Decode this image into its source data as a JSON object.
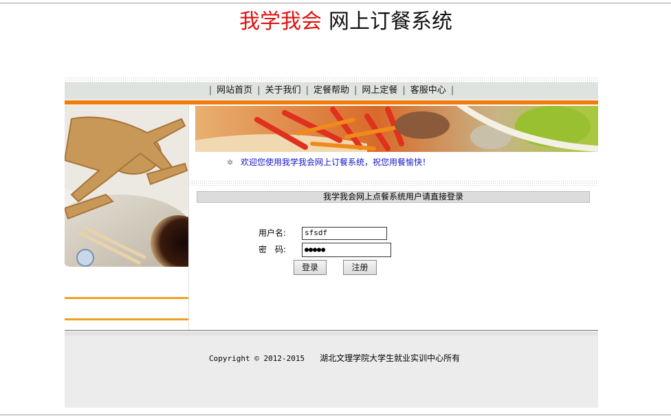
{
  "header": {
    "title_red": "我学我会",
    "title_black": "网上订餐系统"
  },
  "nav": {
    "items": [
      {
        "label": "网站首页"
      },
      {
        "label": "关于我们"
      },
      {
        "label": "定餐帮助"
      },
      {
        "label": "网上定餐"
      },
      {
        "label": "客服中心"
      }
    ]
  },
  "welcome": {
    "icon": "sparkle-icon",
    "text": "欢迎您使用我学我会网上订餐系统，祝您用餐愉快！"
  },
  "login": {
    "panel_title": "我学我会网上点餐系统用户请直接登录",
    "username_label": "用户名:",
    "username_value": "sfsdf",
    "password_label": "密　码:",
    "password_value": "●●●●●",
    "login_button": "登录",
    "register_button": "注册"
  },
  "footer": {
    "copyright": "Copyright © 2012-2015",
    "owner": "湖北文理学院大学生就业实训中心所有"
  },
  "colors": {
    "accent_orange": "#f07d0a",
    "title_red": "#e01010",
    "welcome_blue": "#1414c8"
  }
}
